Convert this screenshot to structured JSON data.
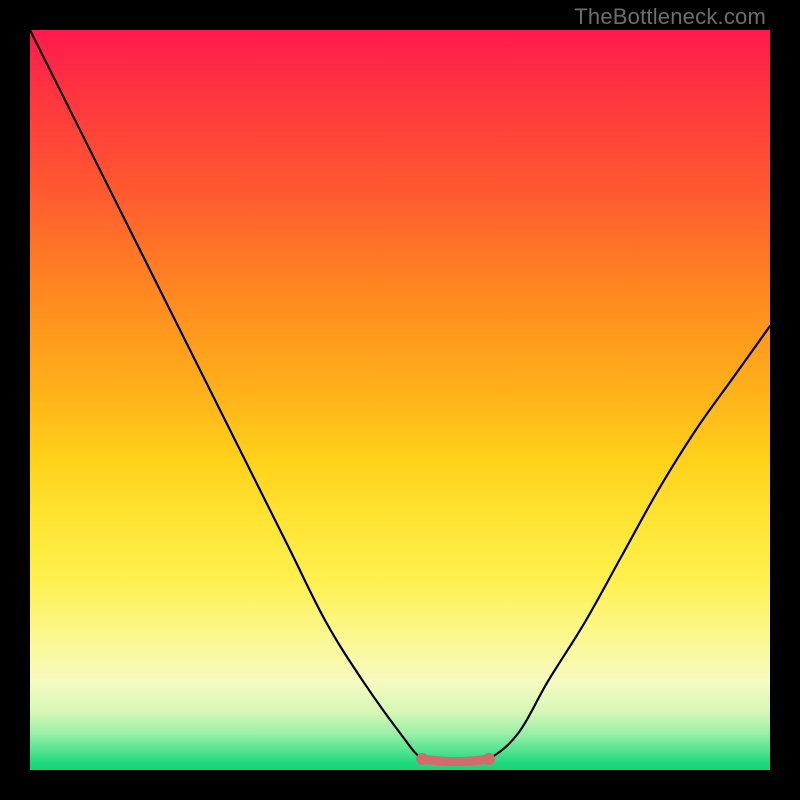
{
  "attribution": "TheBottleneck.com",
  "chart_data": {
    "type": "line",
    "title": "",
    "xlabel": "",
    "ylabel": "",
    "xlim": [
      0,
      100
    ],
    "ylim": [
      0,
      100
    ],
    "x": [
      0,
      5,
      10,
      15,
      20,
      25,
      30,
      35,
      40,
      45,
      50,
      53,
      56,
      59,
      62,
      66,
      70,
      75,
      80,
      85,
      90,
      95,
      100
    ],
    "values": [
      100,
      90,
      80,
      70,
      60,
      50,
      40,
      30,
      20,
      12,
      5,
      1.5,
      1,
      1,
      1.5,
      5,
      12,
      20,
      29,
      38,
      46,
      53,
      60
    ],
    "highlight_range": {
      "x_start": 53,
      "x_end": 62,
      "y": 1
    },
    "gradient_stops": [
      {
        "pos": 0.0,
        "color": "#ff1a4d"
      },
      {
        "pos": 0.5,
        "color": "#ffd11a"
      },
      {
        "pos": 0.85,
        "color": "#fbf890"
      },
      {
        "pos": 1.0,
        "color": "#18d478"
      }
    ]
  }
}
